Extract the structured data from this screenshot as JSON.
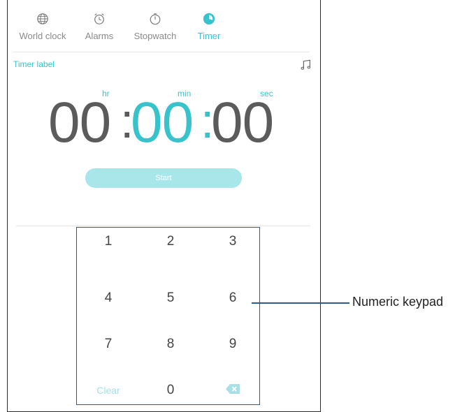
{
  "tabs": [
    {
      "label": "World clock",
      "icon": "globe-icon"
    },
    {
      "label": "Alarms",
      "icon": "alarm-clock-icon"
    },
    {
      "label": "Stopwatch",
      "icon": "stopwatch-icon"
    },
    {
      "label": "Timer",
      "icon": "timer-icon",
      "active": true
    }
  ],
  "timer": {
    "label": "Timer label",
    "units": {
      "hr": "hr",
      "min": "min",
      "sec": "sec"
    },
    "hours": "00",
    "minutes": "00",
    "seconds": "00",
    "separator": ":",
    "start_label": "Start"
  },
  "keypad": {
    "keys": [
      "1",
      "2",
      "3",
      "4",
      "5",
      "6",
      "7",
      "8",
      "9"
    ],
    "clear_label": "Clear",
    "zero": "0",
    "backspace_icon": "backspace-icon"
  },
  "annotation": {
    "text": "Numeric keypad"
  },
  "colors": {
    "accent": "#38c3cc",
    "start_button": "#a8e6ea",
    "callout": "#2a5c8c",
    "digits": "#5b5b5b"
  }
}
